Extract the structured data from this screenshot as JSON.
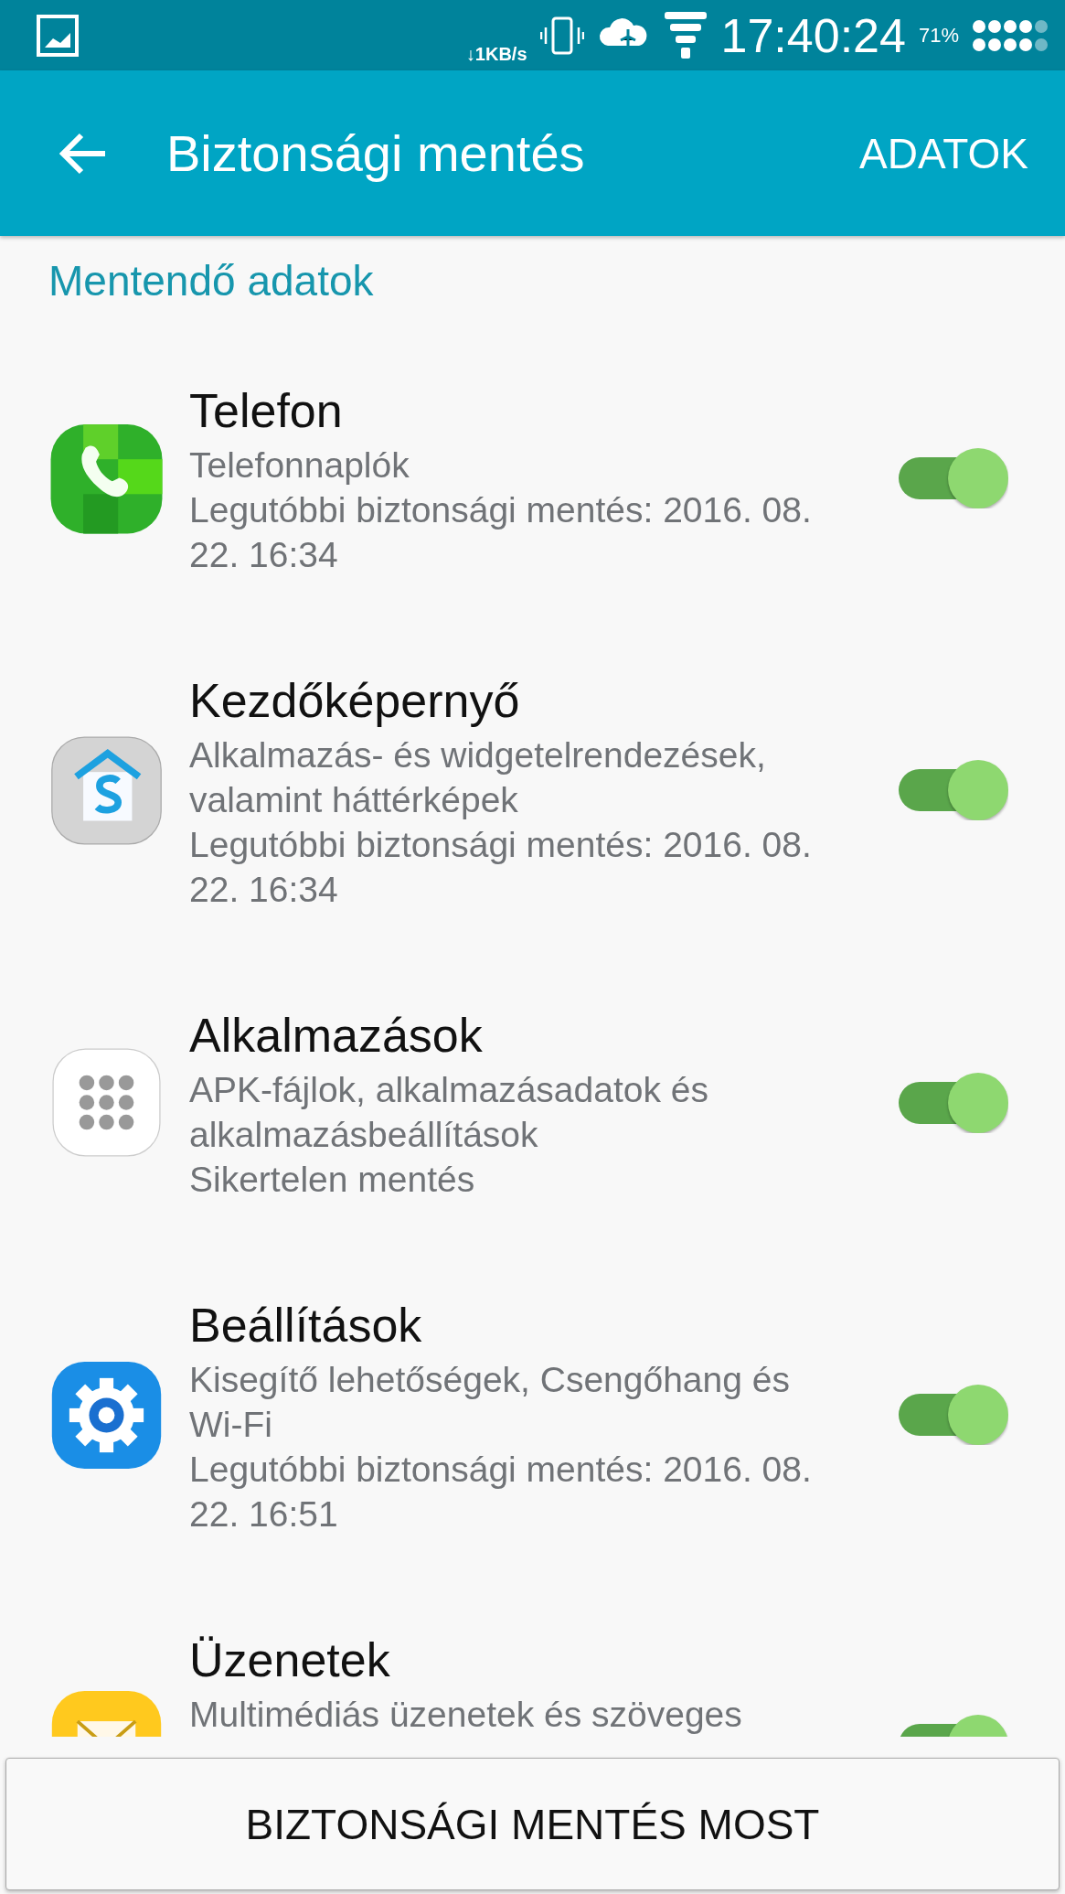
{
  "status_bar": {
    "speed": "↓1KB/s",
    "time": "17:40:24",
    "battery": "71%"
  },
  "app_bar": {
    "title": "Biztonsági mentés",
    "action": "ADATOK"
  },
  "section": {
    "title": "Mentendő adatok"
  },
  "items": [
    {
      "title": "Telefon",
      "lines": [
        "Telefonnaplók",
        "Legutóbbi biztonsági mentés: 2016. 08. 22. 16:34"
      ],
      "on": true
    },
    {
      "title": "Kezdőképernyő",
      "lines": [
        "Alkalmazás- és widgetelrendezések, valamint háttérképek",
        "Legutóbbi biztonsági mentés: 2016. 08. 22. 16:34"
      ],
      "on": true
    },
    {
      "title": "Alkalmazások",
      "lines": [
        "APK-fájlok, alkalmazásadatok és alkalmazásbeállítások",
        "Sikertelen mentés"
      ],
      "on": true
    },
    {
      "title": "Beállítások",
      "lines": [
        "Kisegítő lehetőségek, Csengőhang és Wi-Fi",
        "Legutóbbi biztonsági mentés: 2016. 08. 22. 16:51"
      ],
      "on": true
    },
    {
      "title": "Üzenetek",
      "lines": [
        "Multimédiás üzenetek és szöveges"
      ],
      "on": true
    }
  ],
  "bottom_button": {
    "label": "BIZTONSÁGI MENTÉS MOST"
  }
}
